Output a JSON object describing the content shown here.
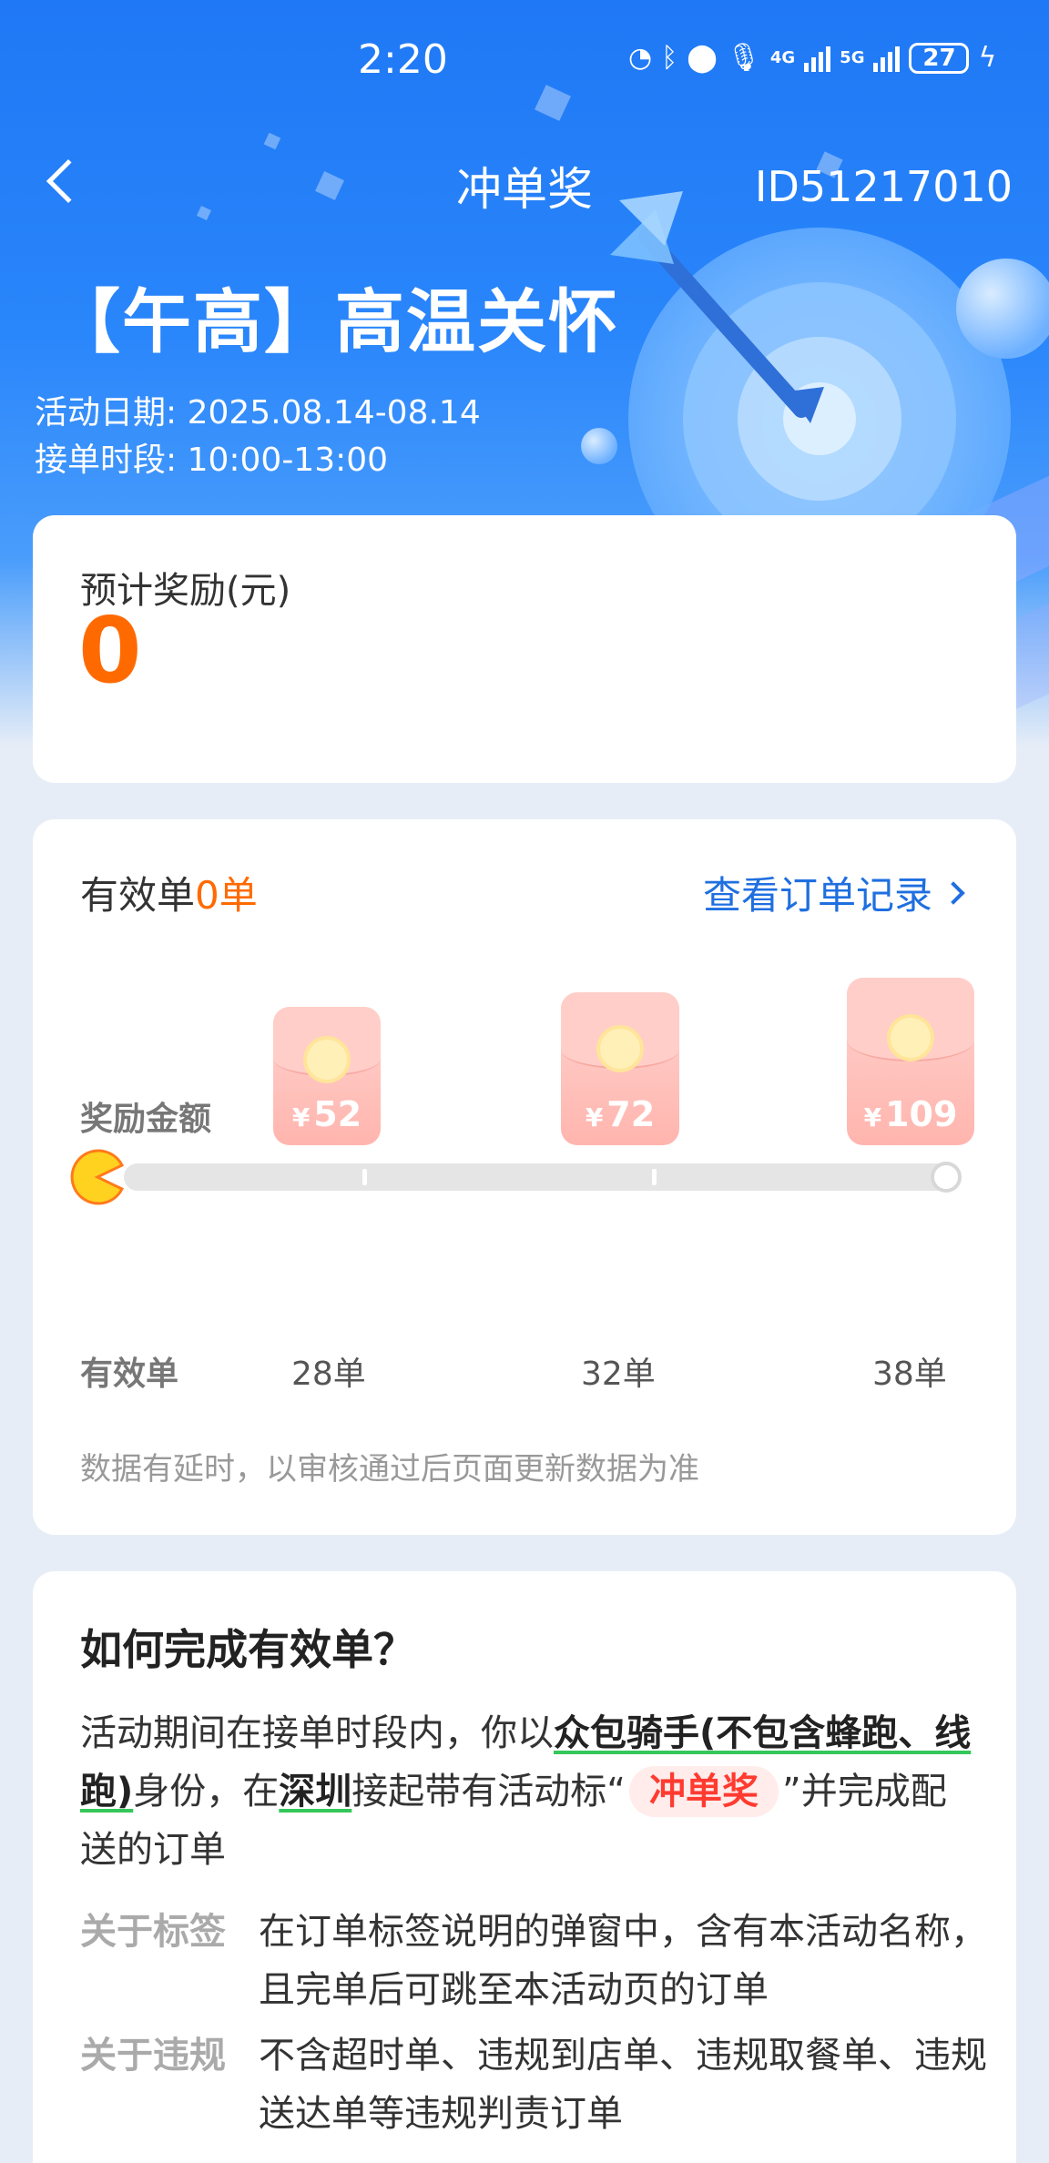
{
  "status_bar": {
    "time": "2:20",
    "battery": "27",
    "network_labels": [
      "4G",
      "5G"
    ]
  },
  "nav": {
    "title": "冲单奖",
    "id": "ID51217010"
  },
  "activity": {
    "title": "【午高】高温关怀",
    "date_label": "活动日期: 2025.08.14-08.14",
    "time_label": "接单时段: 10:00-13:00"
  },
  "reward": {
    "label": "预计奖励(元)",
    "value": "0"
  },
  "progress": {
    "valid_prefix": "有效单",
    "valid_count": "0单",
    "view_records": "查看订单记录",
    "reward_row_label": "奖励金额",
    "currency": "¥",
    "tiers": [
      {
        "amount": "52",
        "orders": "28单"
      },
      {
        "amount": "72",
        "orders": "32单"
      },
      {
        "amount": "109",
        "orders": "38单"
      }
    ],
    "orders_row_label": "有效单",
    "current_progress_fraction": 0,
    "note": "数据有延时，以审核通过后页面更新数据为准"
  },
  "how": {
    "title": "如何完成有效单？",
    "desc_1": "活动期间在接单时段内，你以",
    "desc_role": "众包骑手(不包含蜂跑、线跑)",
    "desc_2": "身份，在",
    "desc_city": "深圳",
    "desc_3": "接起带有活动标“",
    "desc_tag": "冲单奖",
    "desc_4": "”并完成配送的订单",
    "rules": [
      {
        "key": "关于标签",
        "value": "在订单标签说明的弹窗中，含有本活动名称，且完单后可跳至本活动页的订单"
      },
      {
        "key": "关于违规",
        "value": "不含超时单、违规到店单、违规取餐单、违规送达单等违规判责订单"
      }
    ]
  }
}
